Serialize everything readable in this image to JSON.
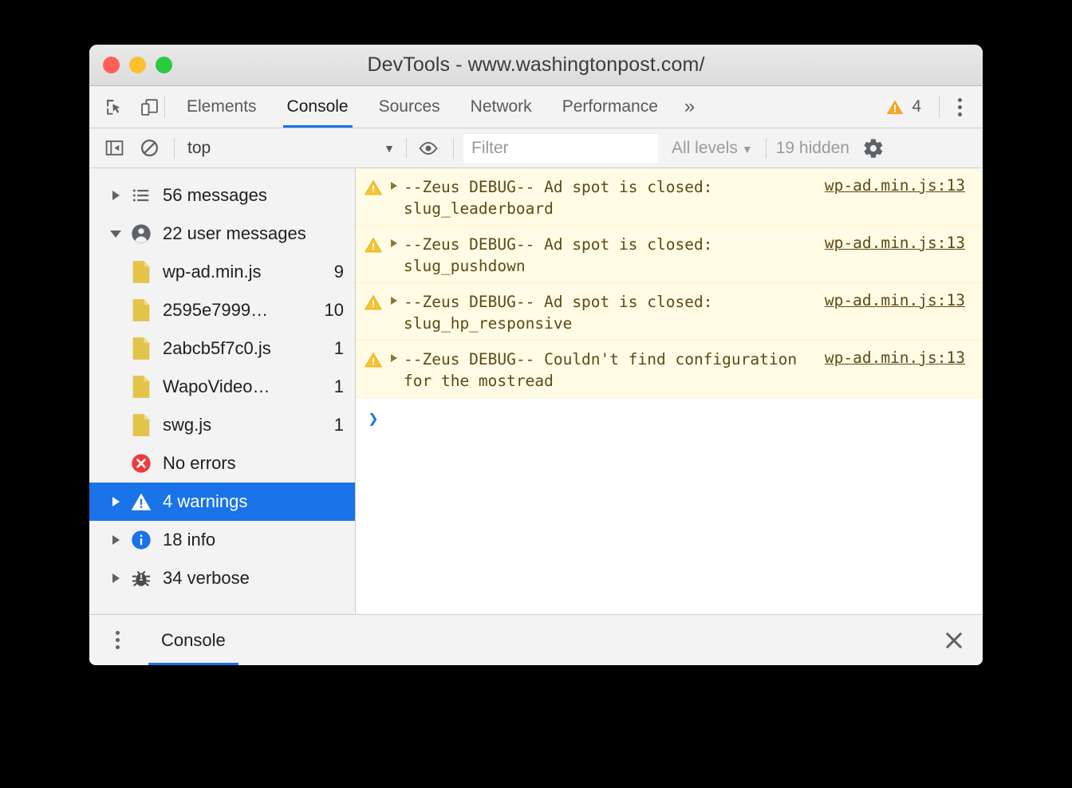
{
  "window": {
    "title": "DevTools - www.washingtonpost.com/",
    "traffic": {
      "close": "close-window",
      "minimize": "minimize-window",
      "zoom": "zoom-window"
    }
  },
  "tabbar": {
    "inspect_icon": "inspect-element-icon",
    "device_icon": "device-toolbar-icon",
    "tabs": [
      {
        "label": "Elements",
        "active": false
      },
      {
        "label": "Console",
        "active": true
      },
      {
        "label": "Sources",
        "active": false
      },
      {
        "label": "Network",
        "active": false
      },
      {
        "label": "Performance",
        "active": false
      }
    ],
    "more_label": "»",
    "warning_count": "4",
    "menu_icon": "more-vertical-icon"
  },
  "console_toolbar": {
    "sidebar_toggle_icon": "show-console-sidebar-icon",
    "clear_icon": "clear-console-icon",
    "context": "top",
    "context_caret": "▼",
    "eye_icon": "live-expression-icon",
    "filter_placeholder": "Filter",
    "filter_value": "",
    "levels_label": "All levels",
    "levels_caret": "▼",
    "hidden_label": "19 hidden",
    "settings_icon": "settings-gear-icon"
  },
  "sidebar": {
    "items": [
      {
        "name": "all-messages",
        "icon": "list-icon",
        "label": "56 messages",
        "count": "",
        "twisty": "right",
        "selected": false,
        "indent": false
      },
      {
        "name": "user-messages",
        "icon": "person-icon",
        "label": "22 user messages",
        "count": "",
        "twisty": "down",
        "selected": false,
        "indent": false
      },
      {
        "name": "file-wp-ad",
        "icon": "file-icon",
        "label": "wp-ad.min.js",
        "count": "9",
        "twisty": "none",
        "selected": false,
        "indent": true
      },
      {
        "name": "file-2595e7999",
        "icon": "file-icon",
        "label": "2595e7999…",
        "count": "10",
        "twisty": "none",
        "selected": false,
        "indent": true
      },
      {
        "name": "file-2abcb5f7c0",
        "icon": "file-icon",
        "label": "2abcb5f7c0.js",
        "count": "1",
        "twisty": "none",
        "selected": false,
        "indent": true
      },
      {
        "name": "file-wapovideo",
        "icon": "file-icon",
        "label": "WapoVideo…",
        "count": "1",
        "twisty": "none",
        "selected": false,
        "indent": true
      },
      {
        "name": "file-swg",
        "icon": "file-icon",
        "label": "swg.js",
        "count": "1",
        "twisty": "none",
        "selected": false,
        "indent": true
      },
      {
        "name": "no-errors",
        "icon": "error-icon",
        "label": "No errors",
        "count": "",
        "twisty": "none",
        "selected": false,
        "indent": false
      },
      {
        "name": "warnings",
        "icon": "warning-icon",
        "label": "4 warnings",
        "count": "",
        "twisty": "right",
        "selected": true,
        "indent": false
      },
      {
        "name": "info",
        "icon": "info-icon",
        "label": "18 info",
        "count": "",
        "twisty": "right",
        "selected": false,
        "indent": false
      },
      {
        "name": "verbose",
        "icon": "bug-icon",
        "label": "34 verbose",
        "count": "",
        "twisty": "right",
        "selected": false,
        "indent": false
      }
    ]
  },
  "console": {
    "messages": [
      {
        "level": "warning",
        "text": "--Zeus DEBUG-- Ad spot is closed: slug_leaderboard",
        "source": "wp-ad.min.js:13"
      },
      {
        "level": "warning",
        "text": "--Zeus DEBUG-- Ad spot is closed: slug_pushdown",
        "source": "wp-ad.min.js:13"
      },
      {
        "level": "warning",
        "text": "--Zeus DEBUG-- Ad spot is closed: slug_hp_responsive",
        "source": "wp-ad.min.js:13"
      },
      {
        "level": "warning",
        "text": "--Zeus DEBUG-- Couldn't find configuration for the mostread",
        "source": "wp-ad.min.js:13"
      }
    ],
    "prompt_chevron": "❯"
  },
  "drawer": {
    "menu_icon": "more-vertical-icon",
    "tab_label": "Console",
    "close_icon": "close-drawer-icon"
  },
  "colors": {
    "accent": "#1a73e8",
    "warning": "#f5a623",
    "error": "#ef3b3b",
    "info": "#1a73e8",
    "warning_bg": "#fffbe5",
    "warning_text": "#5c4a16",
    "file_icon": "#e5c council"
  }
}
